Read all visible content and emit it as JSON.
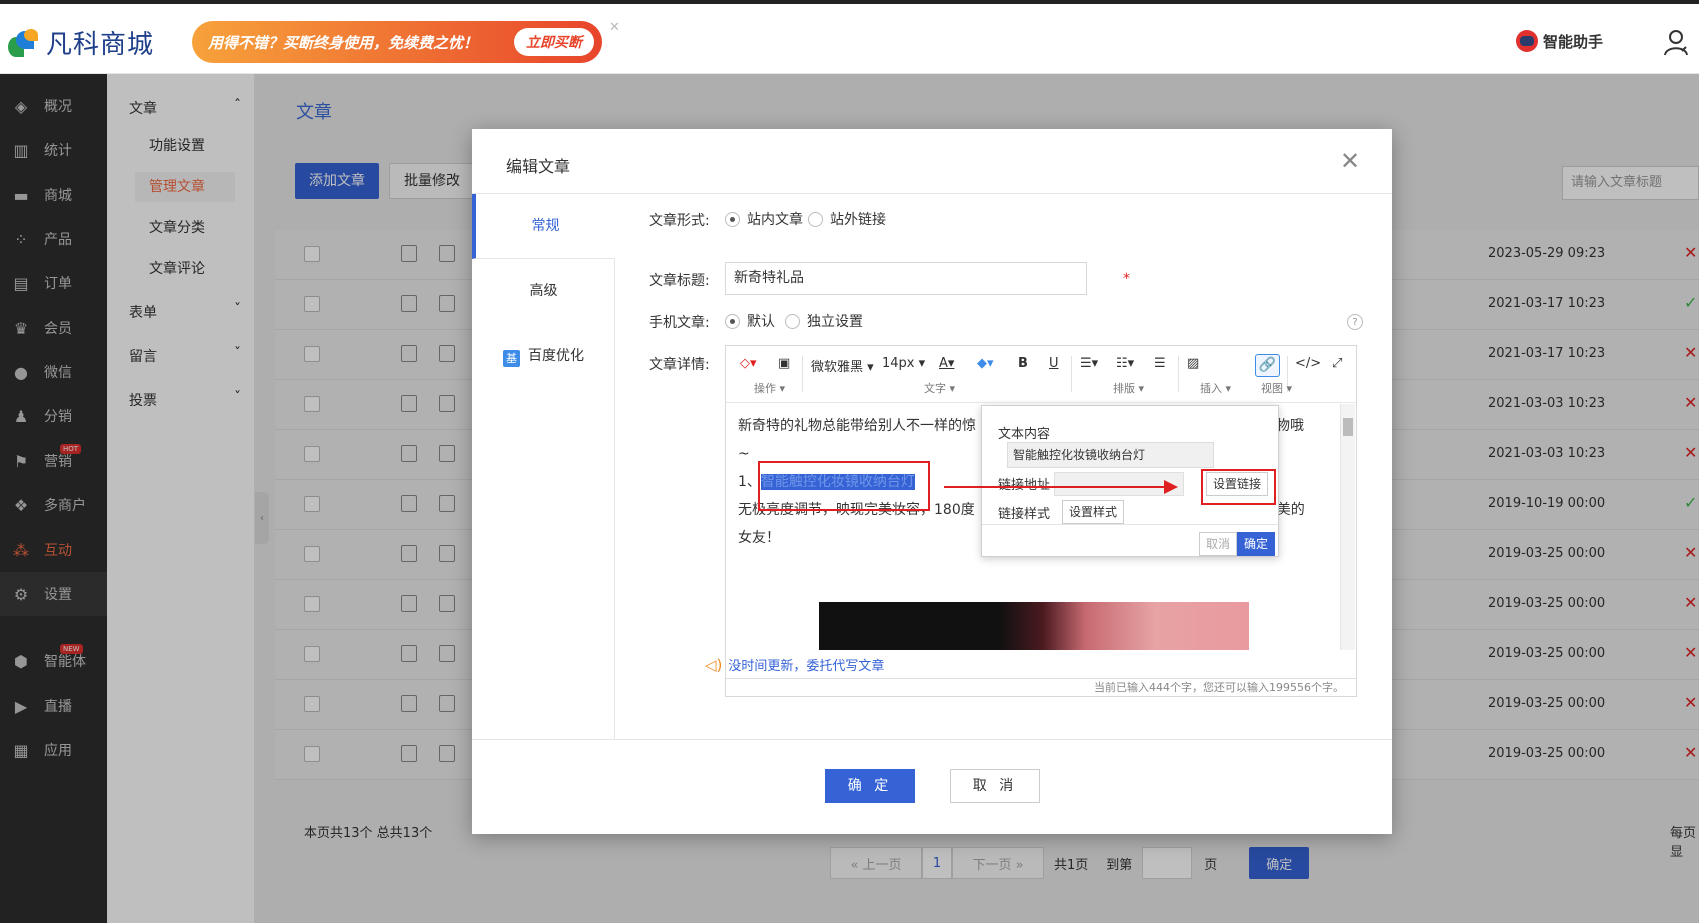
{
  "header": {
    "logo_text": "凡科商城",
    "promo_text": "用得不错？买断终身使用，免续费之忧！",
    "promo_button": "立即买断",
    "assistant_label": "智能助手"
  },
  "sidebar": {
    "items": [
      {
        "label": "概况",
        "icon": "dashboard-icon"
      },
      {
        "label": "统计",
        "icon": "chart-icon"
      },
      {
        "label": "商城",
        "icon": "store-icon"
      },
      {
        "label": "产品",
        "icon": "product-icon"
      },
      {
        "label": "订单",
        "icon": "order-icon"
      },
      {
        "label": "会员",
        "icon": "crown-icon"
      },
      {
        "label": "微信",
        "icon": "wechat-icon"
      },
      {
        "label": "分销",
        "icon": "share-icon"
      },
      {
        "label": "营销",
        "icon": "flag-icon",
        "badge": "HOT"
      },
      {
        "label": "多商户",
        "icon": "merchant-icon"
      },
      {
        "label": "互动",
        "icon": "interact-icon"
      },
      {
        "label": "设置",
        "icon": "gear-icon"
      },
      {
        "label": "智能体",
        "icon": "cube-icon",
        "badge": "NEW"
      },
      {
        "label": "直播",
        "icon": "live-icon"
      },
      {
        "label": "应用",
        "icon": "apps-icon"
      }
    ]
  },
  "submenu": {
    "group_article": "文章",
    "links": [
      "功能设置",
      "管理文章",
      "文章分类",
      "文章评论"
    ],
    "groups": [
      "表单",
      "留言",
      "投票"
    ]
  },
  "main": {
    "title": "文章",
    "add_button": "添加文章",
    "batch_button": "批量修改",
    "search_placeholder": "请输入文章标题",
    "rows": [
      {
        "date": "2023-05-29 09:23",
        "status": "✕"
      },
      {
        "date": "2021-03-17 10:23",
        "status": "✓"
      },
      {
        "date": "2021-03-17 10:23",
        "status": "✕"
      },
      {
        "date": "2021-03-03 10:23",
        "status": "✕"
      },
      {
        "date": "2021-03-03 10:23",
        "status": "✕"
      },
      {
        "date": "2019-10-19 00:00",
        "status": "✓"
      },
      {
        "date": "2019-03-25 00:00",
        "status": "✕"
      },
      {
        "date": "2019-03-25 00:00",
        "status": "✕"
      },
      {
        "date": "2019-03-25 00:00",
        "status": "✕"
      },
      {
        "date": "2019-03-25 00:00",
        "status": "✕"
      },
      {
        "date": "2019-03-25 00:00",
        "status": "✕"
      }
    ],
    "footer_count": "本页共13个  总共13个",
    "footer_per_page": "每页显",
    "pager": {
      "prev": "« 上一页",
      "page": "1",
      "next": "下一页 »",
      "total": "共1页",
      "goto": "到第",
      "page_unit": "页",
      "confirm": "确定"
    }
  },
  "modal": {
    "title": "编辑文章",
    "tabs": [
      "常规",
      "高级",
      "百度优化"
    ],
    "seo_icon_text": "基",
    "form": {
      "type_label": "文章形式:",
      "type_opt1": "站内文章",
      "type_opt2": "站外链接",
      "title_label": "文章标题:",
      "title_value": "新奇特礼品",
      "required_mark": "*",
      "mobile_label": "手机文章:",
      "mobile_opt1": "默认",
      "mobile_opt2": "独立设置",
      "help_mark": "?",
      "detail_label": "文章详情:"
    },
    "toolbar": {
      "font": "微软雅黑",
      "size": "14px",
      "bold": "B",
      "underline": "U",
      "labels": [
        "操作",
        "文字",
        "排版",
        "插入",
        "视图"
      ]
    },
    "editor": {
      "line1": "新奇特的礼物总能带给别人不一样的惊",
      "line1_end": "礼物哦",
      "line2": "~",
      "line3_prefix": "1、",
      "selected": "智能触控化妆镜收纳台灯",
      "line4": "无极亮度调节，映现完美妆容，180度",
      "line4_end": "爱美的",
      "line5": "女友！",
      "status": "当前已输入444个字，您还可以输入199556个字。"
    },
    "link_popup": {
      "text_label": "文本内容",
      "text_value": "智能触控化妆镜收纳台灯",
      "url_label": "链接地址",
      "set_link": "设置链接",
      "style_label": "链接样式",
      "set_style": "设置样式",
      "cancel": "取消",
      "ok": "确定"
    },
    "ai_hint": "没时间更新，委托代写文章",
    "ok_button": "确 定",
    "cancel_button": "取 消"
  }
}
